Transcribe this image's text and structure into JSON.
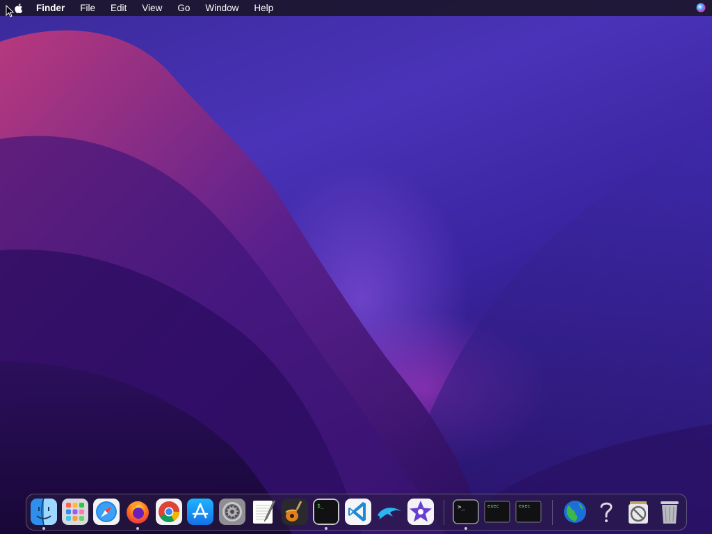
{
  "menubar": {
    "apple_icon": "apple-logo-icon",
    "app_name": "Finder",
    "items": [
      "File",
      "Edit",
      "View",
      "Go",
      "Window",
      "Help"
    ],
    "status_icon": "siri-icon"
  },
  "dock": {
    "apps": [
      {
        "name": "Finder",
        "icon": "finder-icon",
        "running": true
      },
      {
        "name": "Launchpad",
        "icon": "launchpad-icon",
        "running": false
      },
      {
        "name": "Safari",
        "icon": "safari-icon",
        "running": false
      },
      {
        "name": "Firefox",
        "icon": "firefox-icon",
        "running": true
      },
      {
        "name": "Chrome",
        "icon": "chrome-icon",
        "running": false
      },
      {
        "name": "App Store",
        "icon": "app-store-icon",
        "running": false
      },
      {
        "name": "System Preferences",
        "icon": "system-preferences-icon",
        "running": false
      },
      {
        "name": "TextEdit",
        "icon": "textedit-icon",
        "running": false
      },
      {
        "name": "GarageBand",
        "icon": "garageband-icon",
        "running": false
      },
      {
        "name": "Terminal",
        "icon": "terminal-icon",
        "running": true
      },
      {
        "name": "Visual Studio Code",
        "icon": "vscode-icon",
        "running": false
      },
      {
        "name": "Dolphin",
        "icon": "dolphin-icon",
        "running": false
      },
      {
        "name": "iMovie",
        "icon": "imovie-icon",
        "running": false
      }
    ],
    "recents": [
      {
        "name": "Terminal Window",
        "icon": "terminal-prompt-icon",
        "running": true,
        "label": ">_"
      },
      {
        "name": "exec",
        "icon": "exec-icon",
        "running": false,
        "label": "exec"
      },
      {
        "name": "exec",
        "icon": "exec-icon",
        "running": false,
        "label": "exec"
      }
    ],
    "extras": [
      {
        "name": "Network",
        "icon": "globe-icon"
      },
      {
        "name": "Help",
        "icon": "question-mark-icon"
      },
      {
        "name": "Utility",
        "icon": "no-entry-icon"
      },
      {
        "name": "Trash",
        "icon": "trash-icon"
      }
    ],
    "recents_labels": {
      "prompt": ">_",
      "exec1": "exec",
      "exec2": "exec"
    }
  }
}
